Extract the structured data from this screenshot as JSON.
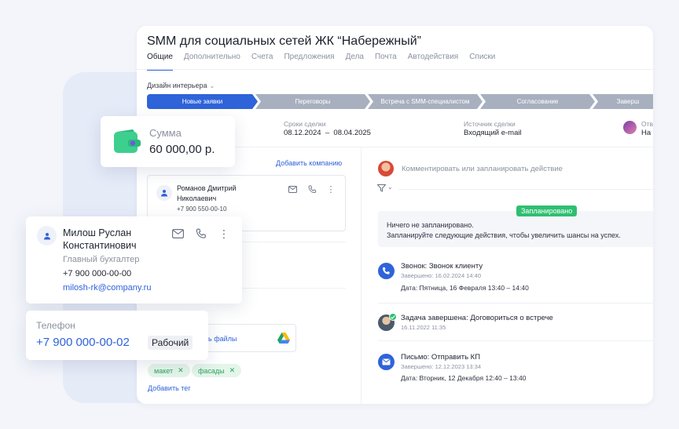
{
  "deal": {
    "title": "SMM для социальных сетей ЖК “Набережный”",
    "tabs": [
      {
        "label": "Общие",
        "active": true
      },
      {
        "label": "Дополнительно"
      },
      {
        "label": "Счета"
      },
      {
        "label": "Предложения"
      },
      {
        "label": "Дела"
      },
      {
        "label": "Почта"
      },
      {
        "label": "Автодействия"
      },
      {
        "label": "Списки"
      }
    ],
    "pipeline_name": "Дизайн интерьера",
    "stages": [
      {
        "label": "Новые заявки",
        "active": true
      },
      {
        "label": "Переговоры"
      },
      {
        "label": "Встреча с SMM-специалистом"
      },
      {
        "label": "Согласование"
      },
      {
        "label": "Заверш"
      }
    ],
    "terms_label": "Сроки сделки",
    "terms_start": "08.12.2024",
    "terms_dash": "–",
    "terms_end": "08.04.2025",
    "source_label": "Источник сделки",
    "source_value": "Входящий e-mail",
    "resp_label": "Отв",
    "resp_value": "На"
  },
  "left": {
    "add_company": "Добавить компанию",
    "contact": {
      "name_line1": "Романов Дмитрий",
      "name_line2": "Николаевич",
      "phone": "+7 900 550-00-10"
    },
    "files_label": "ь файлы",
    "tags": [
      {
        "label": "макет",
        "color": "#2fa35f",
        "bg": "#e4f5ea"
      },
      {
        "label": "фасады",
        "color": "#2fa35f",
        "bg": "#e4f5ea"
      }
    ],
    "add_tag": "Добавить тег"
  },
  "right": {
    "comment_placeholder": "Комментировать или запланировать действие",
    "planned_badge": "Запланировано",
    "planned_line1": "Ничего не запланировано.",
    "planned_line2": "Запланируйте следующие действия, чтобы увеличить шансы на успех.",
    "activities": [
      {
        "title": "Звонок: Звонок клиенту",
        "sub": "Завершено: 16.02.2024 14:40",
        "detail": "Дата: Пятница, 16 Февраля 13:40  – 14:40",
        "icon": "phone-icon"
      },
      {
        "title": "Задача завершена: Договориться о встрече",
        "sub": "16.11.2022 11:35",
        "detail": "",
        "icon": "avatar"
      },
      {
        "title": "Письмо: Отправить КП",
        "sub": "Завершено: 12.12.2023 13:34",
        "detail": "Дата: Вторник, 12 Декабря 12:40  – 13:40",
        "icon": "mail-icon"
      }
    ]
  },
  "sum_card": {
    "label": "Сумма",
    "value": "60 000,00 р."
  },
  "contact_card": {
    "name_line1": "Милош Руслан",
    "name_line2": "Константинович",
    "role": "Главный бухгалтер",
    "phone": "+7 900 000-00-00",
    "email": "milosh-rk@company.ru"
  },
  "phone_card": {
    "label": "Телефон",
    "value": "+7 900 000-00-02",
    "type": "Рабочий"
  },
  "colors": {
    "accent": "#2f63d9",
    "stage_inactive": "#a8b0bf",
    "green": "#2fbf71",
    "wallet": "#3ccf8e"
  }
}
